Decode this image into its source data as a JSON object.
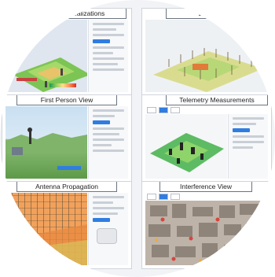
{
  "panels": [
    {
      "title": "...alizations"
    },
    {
      "title": "E..."
    },
    {
      "title": "First Person View"
    },
    {
      "title": "Telemetry Measurements"
    },
    {
      "title": "Antenna Propagation"
    },
    {
      "title": "Interference View"
    }
  ],
  "colors": {
    "frame_border": "#cfd5dc",
    "accent_blue": "#2f7de1",
    "terrain_green": "#6cc24a",
    "heat_orange": "#f2a15b"
  }
}
